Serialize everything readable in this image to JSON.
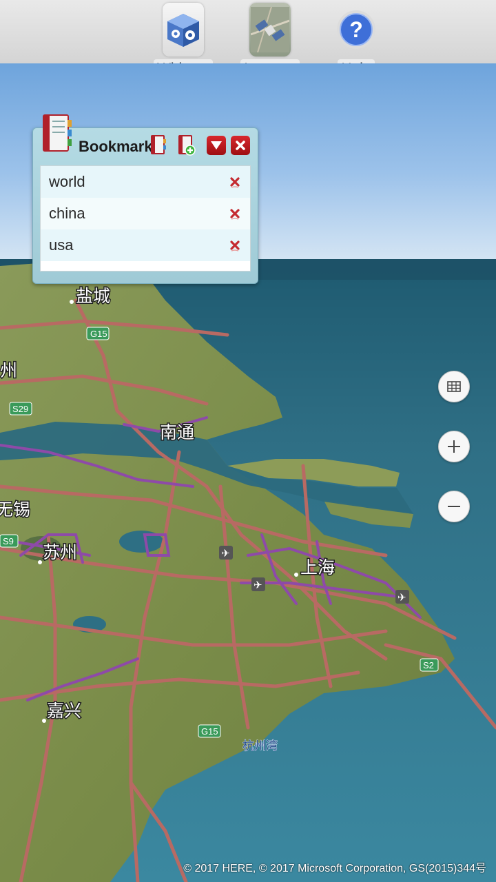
{
  "toolbar": {
    "items": [
      {
        "label": "Widgets",
        "icon": "widgets-cube-gears-icon"
      },
      {
        "label": "Imagery",
        "icon": "satellite-icon"
      },
      {
        "label": "Help",
        "icon": "help-question-icon"
      }
    ]
  },
  "bookmarks": {
    "title": "Bookmarks",
    "items": [
      {
        "label": "world"
      },
      {
        "label": "china"
      },
      {
        "label": "usa"
      }
    ]
  },
  "map": {
    "cities": [
      "盐城",
      "南通",
      "苏州",
      "上海",
      "嘉兴"
    ],
    "edge_labels": [
      "州",
      "无锡"
    ],
    "road_shields": [
      "G15",
      "S29",
      "S9",
      "S2",
      "G15"
    ],
    "water_label": "杭州湾",
    "controls": [
      "grid-icon",
      "zoom-in-icon",
      "zoom-out-icon"
    ],
    "attribution": "© 2017 HERE, © 2017 Microsoft Corporation, GS(2015)344号"
  },
  "colors": {
    "ocean": "#2e6f86",
    "land": "#7c8f4a",
    "expressway": "#b86a63",
    "urban_road": "#8e4aa8",
    "close_red": "#c0141a"
  }
}
